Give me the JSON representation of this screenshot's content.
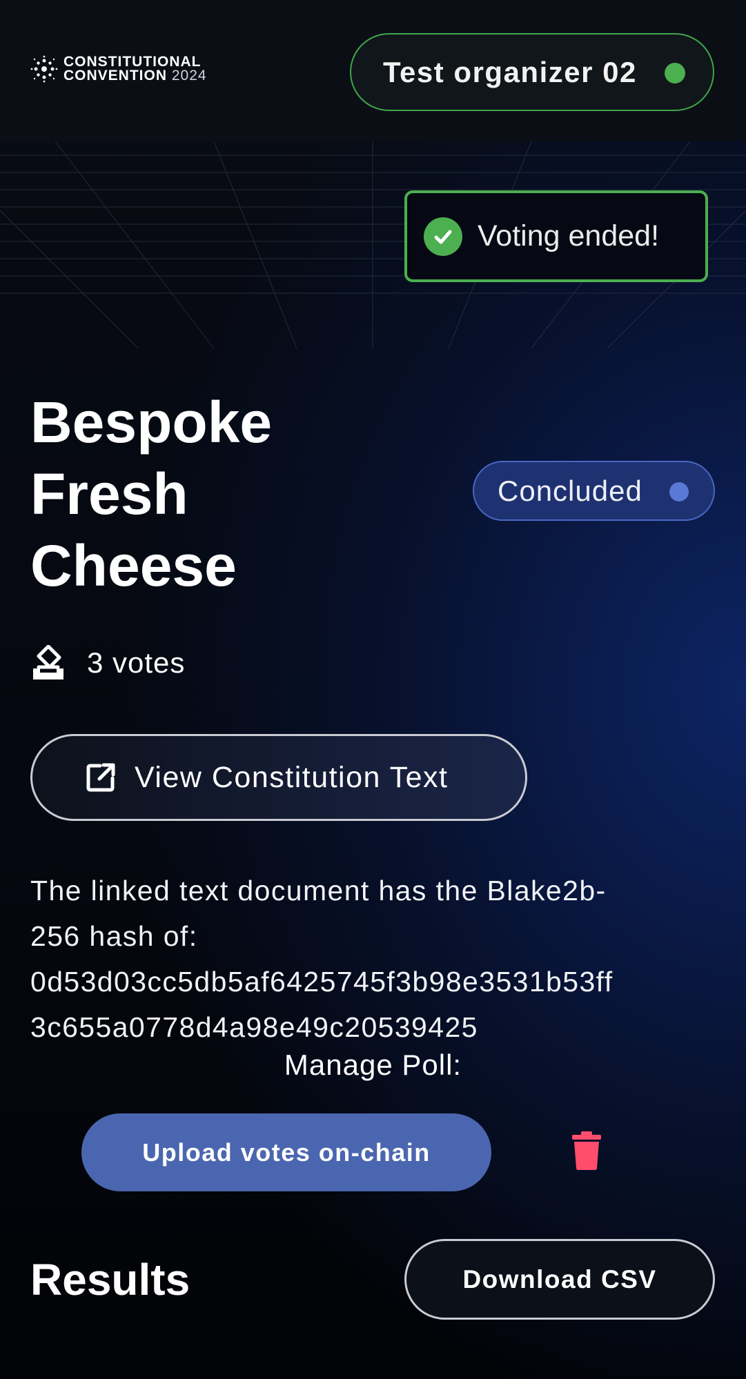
{
  "header": {
    "logo": {
      "line1": "CONSTITUTIONAL",
      "line2": "CONVENTION",
      "year": "2024",
      "icon": "sparkle-logo-icon"
    },
    "user": {
      "name": "Test organizer 02",
      "status_color": "#4caf50"
    }
  },
  "toast": {
    "message": "Voting ended!",
    "icon": "check-circle-icon",
    "color": "#4caf50"
  },
  "poll": {
    "title_lines": [
      "Bespoke",
      "Fresh",
      "Cheese"
    ],
    "status": {
      "label": "Concluded",
      "color": "#4a66c4"
    },
    "votes": {
      "text": "3 votes",
      "icon": "ballot-box-icon"
    },
    "view_button": {
      "label": "View Constitution Text",
      "icon": "external-link-icon"
    },
    "hash": {
      "line1": "The linked text document has the Blake2b-",
      "line2": "256 hash of:",
      "line3": "0d53d03cc5db5af6425745f3b98e3531b53ff",
      "line4": "3c655a0778d4a98e49c20539425"
    }
  },
  "manage": {
    "label": "Manage Poll:",
    "upload_label": "Upload votes on-chain",
    "delete_icon": "trash-icon",
    "delete_color": "#ff4d6d"
  },
  "results": {
    "heading": "Results",
    "download_label": "Download CSV"
  },
  "theme": {
    "accent_blue": "#4b66b0",
    "success_green": "#4caf50",
    "background": "#05070c"
  }
}
